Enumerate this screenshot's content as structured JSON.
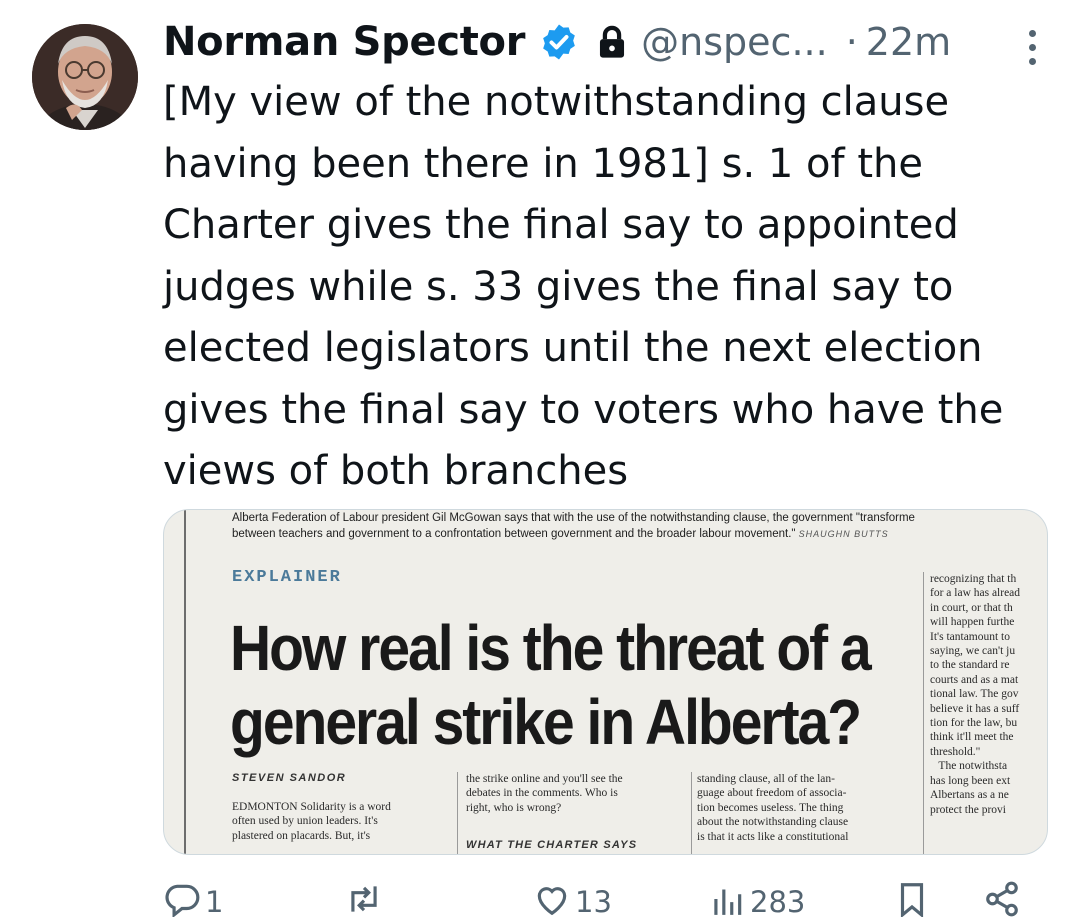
{
  "tweet": {
    "author_name": "Norman Spector",
    "handle": "@nspec...",
    "separator": "·",
    "time": "22m",
    "text": "[My view of the notwithstanding clause having been there in 1981] s. 1 of the Charter gives the final say to appointed judges while s. 33 gives the final say to elected legislators until the next election gives the final say to voters who have the views of both branches"
  },
  "icons": {
    "verified": "verified-badge-icon",
    "lock": "protected-lock-icon",
    "more": "more-options-icon",
    "reply": "reply-icon",
    "retweet": "retweet-icon",
    "like": "like-icon",
    "views": "views-icon",
    "bookmark": "bookmark-icon",
    "share": "share-icon"
  },
  "colors": {
    "verified_blue": "#1d9bf0",
    "secondary_text": "#536471",
    "kicker_blue": "#4b7a9a"
  },
  "media": {
    "caption_line1": "Alberta Federation of Labour president Gil McGowan says that with the use of the notwithstanding clause, the government \"transforme",
    "caption_line2": "between teachers and government to a confrontation between government and the broader labour movement.\"",
    "photo_credit": "SHAUGHN BUTTS",
    "kicker": "EXPLAINER",
    "headline_line1": "How real is the threat of a",
    "headline_line2": "general strike in Alberta?",
    "byline": "STEVEN SANDOR",
    "column1": "EDMONTON Solidarity is a word\noften used by union leaders. It's\nplastered on placards. But, it's",
    "column2": "the strike online and you'll see the\ndebates in the comments. Who is\nright, who is wrong?",
    "subhead": "WHAT THE CHARTER SAYS",
    "column3": "standing clause, all of the lan-\nguage about freedom of associa-\ntion becomes useless. The thing\nabout the notwithstanding clause\nis that it acts like a constitutional",
    "column4": "recognizing that th\nfor a law has alread\nin court, or that th\nwill happen furthe\nIt's tantamount to\nsaying, we can't ju\nto the standard re\ncourts and as a mat\ntional law. The gov\nbelieve it has a suff\ntion for the law, bu\nthink it'll meet the\nthreshold.\"\n   The notwithsta\nhas long been ext\nAlbertans as a ne\nprotect the provi"
  },
  "actions": {
    "replies": "1",
    "retweets": "",
    "likes": "13",
    "views": "283"
  }
}
